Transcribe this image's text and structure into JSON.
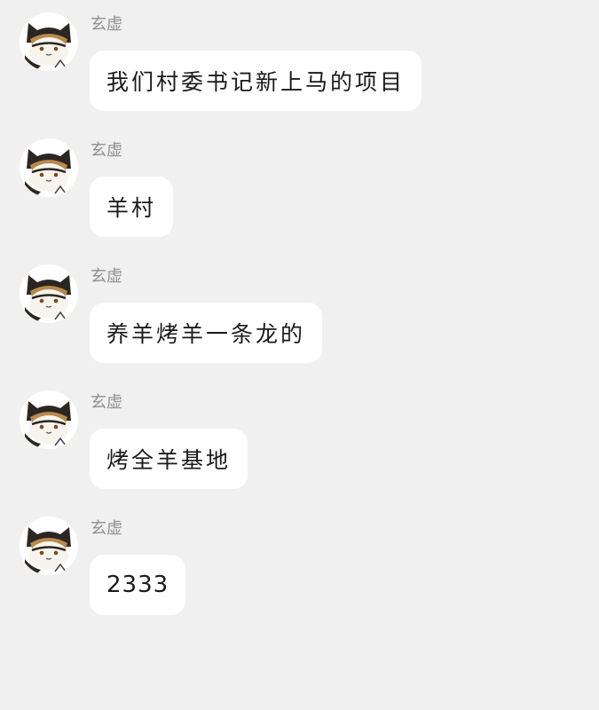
{
  "messages": [
    {
      "sender": "玄虚",
      "avatar_icon": "cat-avatar-icon",
      "text": "我们村委书记新上马的项目"
    },
    {
      "sender": "玄虚",
      "avatar_icon": "cat-avatar-icon",
      "text": "羊村"
    },
    {
      "sender": "玄虚",
      "avatar_icon": "cat-avatar-icon",
      "text": "养羊烤羊一条龙的"
    },
    {
      "sender": "玄虚",
      "avatar_icon": "cat-avatar-icon",
      "text": "烤全羊基地"
    },
    {
      "sender": "玄虚",
      "avatar_icon": "cat-avatar-icon",
      "text": "2333"
    }
  ],
  "colors": {
    "background": "#f0f0f0",
    "bubble": "#ffffff",
    "sender_name": "#8f8f8f",
    "message_text": "#1a1a1a"
  }
}
